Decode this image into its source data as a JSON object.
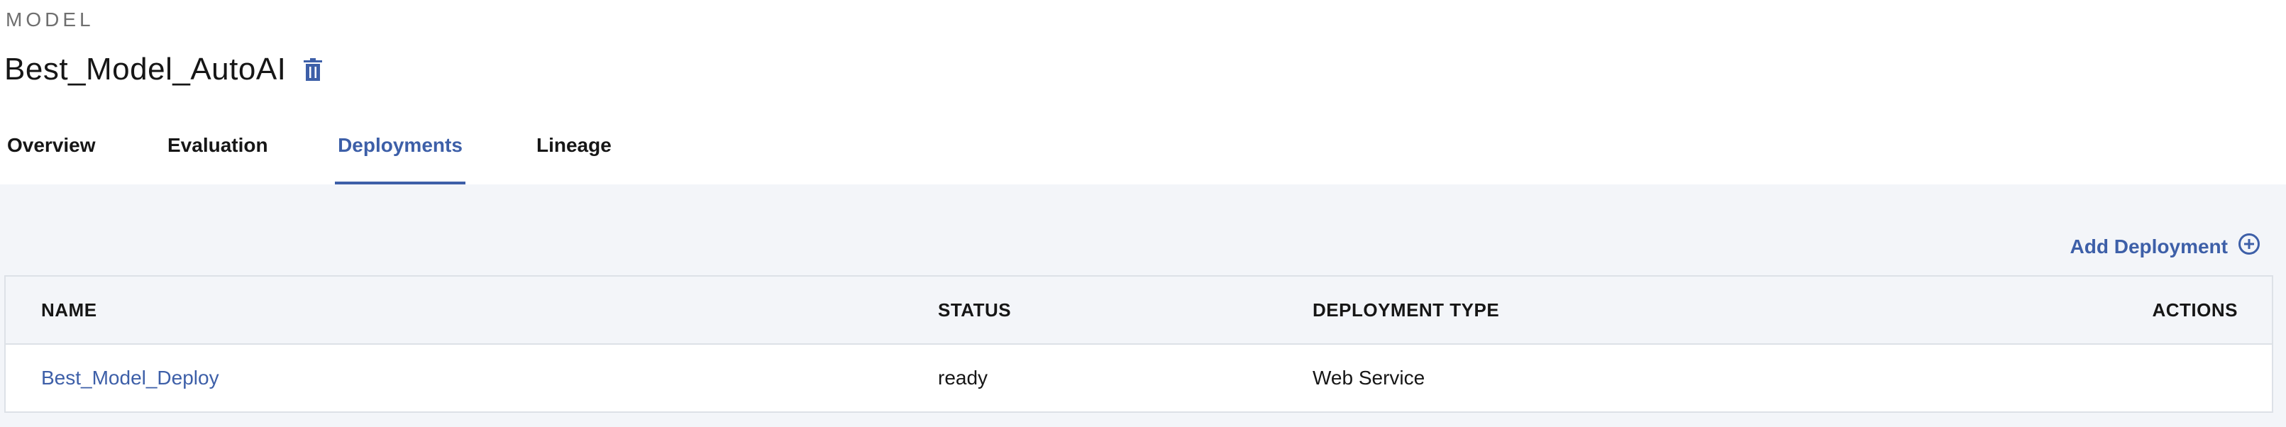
{
  "header": {
    "eyebrow": "MODEL",
    "title": "Best_Model_AutoAI",
    "delete_icon": "trash-icon"
  },
  "tabs": [
    {
      "label": "Overview",
      "active": false
    },
    {
      "label": "Evaluation",
      "active": false
    },
    {
      "label": "Deployments",
      "active": true
    },
    {
      "label": "Lineage",
      "active": false
    }
  ],
  "deployments": {
    "add_label": "Add Deployment",
    "add_icon": "add-circle-icon",
    "columns": [
      "NAME",
      "STATUS",
      "DEPLOYMENT TYPE",
      "ACTIONS"
    ],
    "rows": [
      {
        "name": "Best_Model_Deploy",
        "status": "ready",
        "type": "Web Service",
        "actions": ""
      }
    ]
  },
  "colors": {
    "accent": "#3d5fa8",
    "content_bg": "#f3f5f9",
    "border": "#dde1e7"
  }
}
